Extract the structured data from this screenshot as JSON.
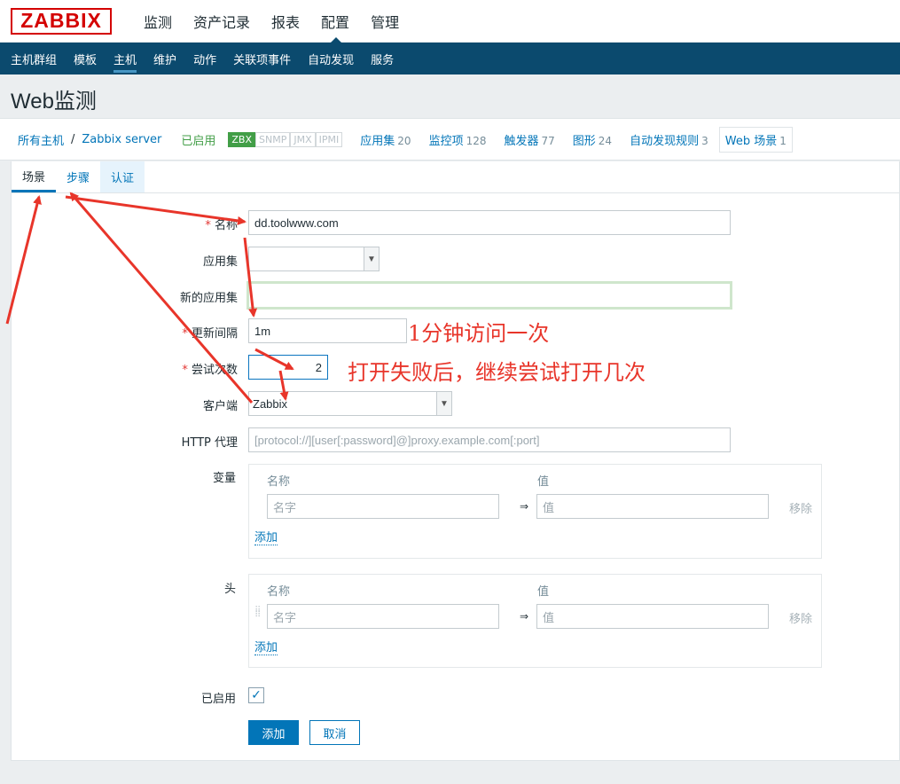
{
  "logo": "ZABBIX",
  "top_nav": [
    "监测",
    "资产记录",
    "报表",
    "配置",
    "管理"
  ],
  "sub_nav": [
    "主机群组",
    "模板",
    "主机",
    "维护",
    "动作",
    "关联项事件",
    "自动发现",
    "服务"
  ],
  "page_title": "Web监测",
  "host_bar": {
    "all_hosts": "所有主机",
    "separator": "/",
    "host_name": "Zabbix server",
    "status": "已启用",
    "availability": [
      "ZBX",
      "SNMP",
      "JMX",
      "IPMI"
    ],
    "links": [
      {
        "label": "应用集",
        "count": "20"
      },
      {
        "label": "监控项",
        "count": "128"
      },
      {
        "label": "触发器",
        "count": "77"
      },
      {
        "label": "图形",
        "count": "24"
      },
      {
        "label": "自动发现规则",
        "count": "3"
      },
      {
        "label": "Web 场景",
        "count": "1"
      }
    ]
  },
  "tabs": [
    "场景",
    "步骤",
    "认证"
  ],
  "form": {
    "name_label": "名称",
    "name_value": "dd.toolwww.com",
    "app_label": "应用集",
    "app_value": "",
    "new_app_label": "新的应用集",
    "new_app_value": "",
    "interval_label": "更新间隔",
    "interval_value": "1m",
    "attempts_label": "尝试次数",
    "attempts_value": "2",
    "agent_label": "客户端",
    "agent_value": "Zabbix",
    "proxy_label": "HTTP 代理",
    "proxy_placeholder": "[protocol://][user[:password]@]proxy.example.com[:port]",
    "variables_label": "变量",
    "headers_label": "头",
    "col_name": "名称",
    "col_value": "值",
    "name_placeholder": "名字",
    "value_placeholder": "值",
    "arrow": "⇒",
    "remove": "移除",
    "add_link": "添加",
    "enabled_label": "已启用",
    "add_button": "添加",
    "cancel_button": "取消"
  },
  "annotations": {
    "interval_note": "1分钟访问一次",
    "attempts_note": "打开失败后，继续尝试打开几次"
  },
  "colors": {
    "brand_red": "#d40000",
    "nav_blue": "#0b4a6e",
    "link_blue": "#0275b8",
    "annotation_red": "#e8352a"
  }
}
